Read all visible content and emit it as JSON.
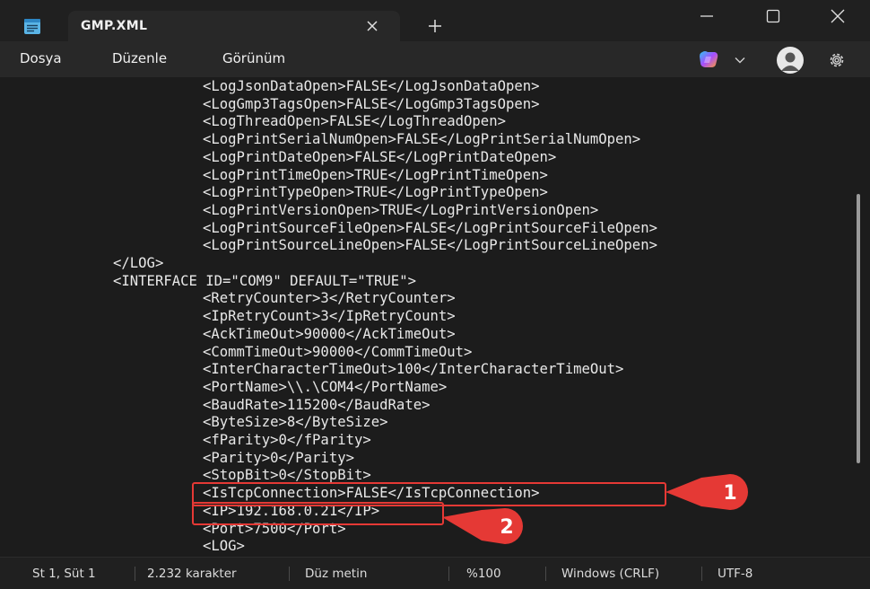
{
  "window": {
    "tab_title": "GMP.XML"
  },
  "menu": {
    "items": [
      "Dosya",
      "Düzenle",
      "Görünüm"
    ]
  },
  "editor": {
    "lines": [
      {
        "indent": 2,
        "text": "<LogJsonDataOpen>FALSE</LogJsonDataOpen>"
      },
      {
        "indent": 2,
        "text": "<LogGmp3TagsOpen>FALSE</LogGmp3TagsOpen>"
      },
      {
        "indent": 2,
        "text": "<LogThreadOpen>FALSE</LogThreadOpen>"
      },
      {
        "indent": 2,
        "text": "<LogPrintSerialNumOpen>FALSE</LogPrintSerialNumOpen>"
      },
      {
        "indent": 2,
        "text": "<LogPrintDateOpen>FALSE</LogPrintDateOpen>"
      },
      {
        "indent": 2,
        "text": "<LogPrintTimeOpen>TRUE</LogPrintTimeOpen>"
      },
      {
        "indent": 2,
        "text": "<LogPrintTypeOpen>TRUE</LogPrintTypeOpen>"
      },
      {
        "indent": 2,
        "text": "<LogPrintVersionOpen>TRUE</LogPrintVersionOpen>"
      },
      {
        "indent": 2,
        "text": "<LogPrintSourceFileOpen>FALSE</LogPrintSourceFileOpen>"
      },
      {
        "indent": 2,
        "text": "<LogPrintSourceLineOpen>FALSE</LogPrintSourceLineOpen>"
      },
      {
        "indent": 1,
        "text": "</LOG>"
      },
      {
        "indent": 1,
        "text": "<INTERFACE ID=\"COM9\" DEFAULT=\"TRUE\">"
      },
      {
        "indent": 2,
        "text": "<RetryCounter>3</RetryCounter>"
      },
      {
        "indent": 2,
        "text": "<IpRetryCount>3</IpRetryCount>"
      },
      {
        "indent": 2,
        "text": "<AckTimeOut>90000</AckTimeOut>"
      },
      {
        "indent": 2,
        "text": "<CommTimeOut>90000</CommTimeOut>"
      },
      {
        "indent": 2,
        "text": "<InterCharacterTimeOut>100</InterCharacterTimeOut>"
      },
      {
        "indent": 2,
        "text": "<PortName>\\\\.\\COM4</PortName>"
      },
      {
        "indent": 2,
        "text": "<BaudRate>115200</BaudRate>"
      },
      {
        "indent": 2,
        "text": "<ByteSize>8</ByteSize>"
      },
      {
        "indent": 2,
        "text": "<fParity>0</fParity>"
      },
      {
        "indent": 2,
        "text": "<Parity>0</Parity>"
      },
      {
        "indent": 2,
        "text": "<StopBit>0</StopBit>"
      },
      {
        "indent": 2,
        "text": "<IsTcpConnection>FALSE</IsTcpConnection>"
      },
      {
        "indent": 2,
        "text": "<IP>192.168.0.21</IP>"
      },
      {
        "indent": 2,
        "text": "<Port>7500</Port>"
      },
      {
        "indent": 2,
        "text": "<LOG>"
      }
    ]
  },
  "annotations": [
    {
      "label": "1",
      "color": "#e53935"
    },
    {
      "label": "2",
      "color": "#e53935"
    }
  ],
  "status": {
    "position": "St 1, Süt 1",
    "char_count": "2.232 karakter",
    "format": "Düz metin",
    "zoom": "%100",
    "line_ending": "Windows (CRLF)",
    "encoding": "UTF-8"
  },
  "icons": {
    "app": "notepad-icon",
    "tab_close": "close-icon",
    "new_tab": "plus-icon",
    "minimize": "minimize-icon",
    "maximize": "maximize-icon",
    "close": "close-icon",
    "copilot": "copilot-icon",
    "dropdown": "chevron-down-icon",
    "account": "avatar",
    "settings": "gear-icon"
  }
}
